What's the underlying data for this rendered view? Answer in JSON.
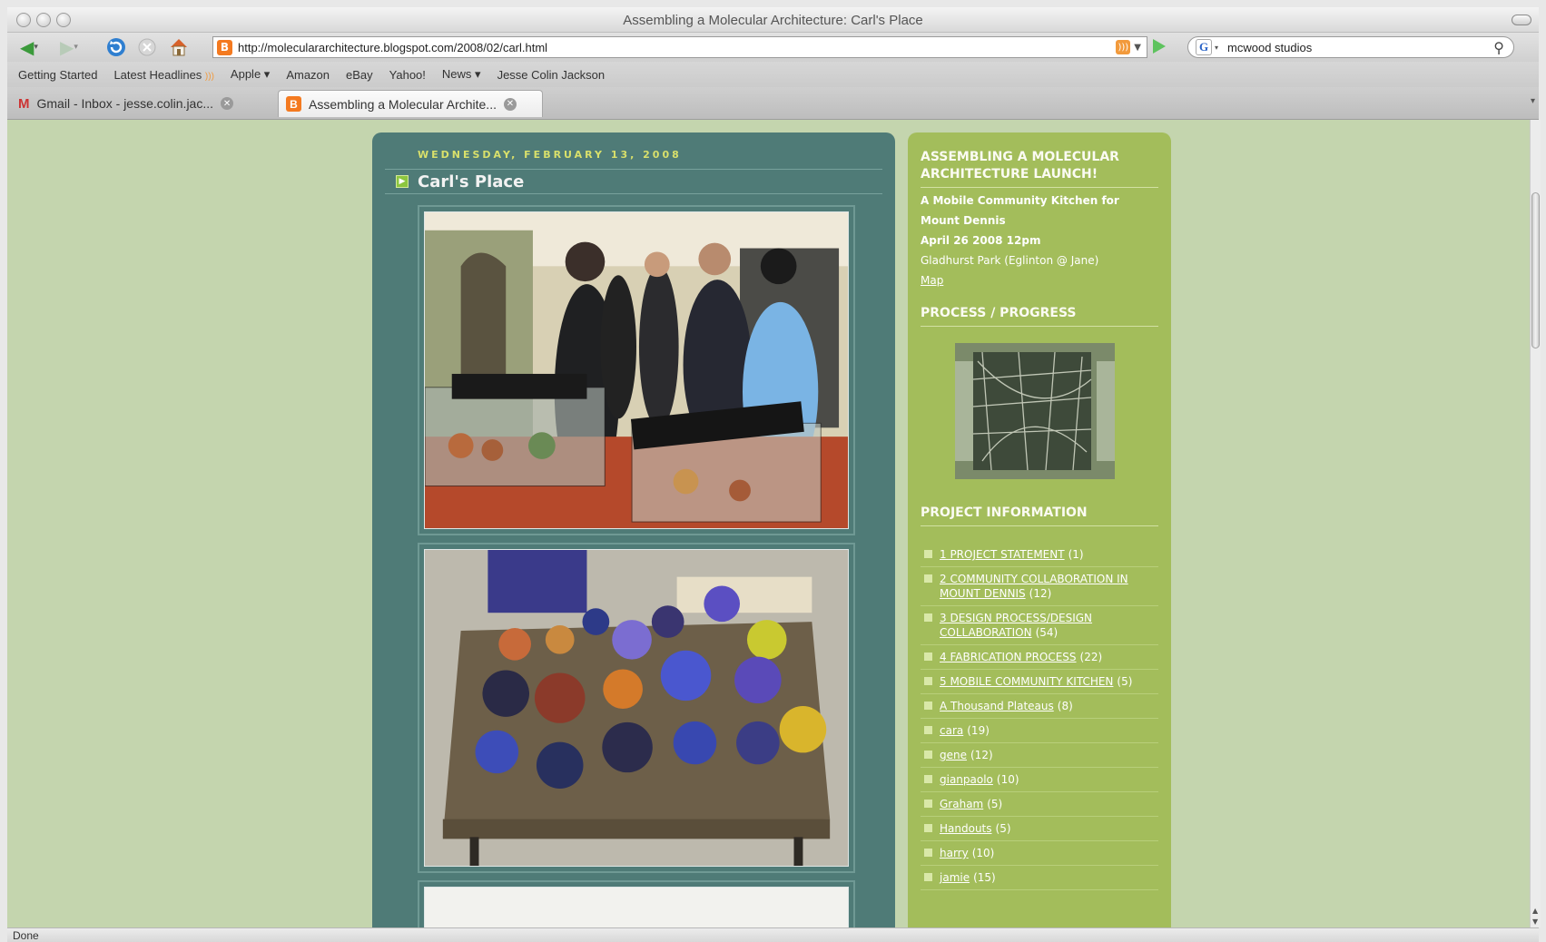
{
  "window": {
    "title": "Assembling a Molecular Architecture: Carl's Place"
  },
  "toolbar": {
    "url": "http://moleculararchitecture.blogspot.com/2008/02/carl.html",
    "search_value": "mcwood studios"
  },
  "bookmarks": [
    "Getting Started",
    "Latest Headlines",
    "Apple ▾",
    "Amazon",
    "eBay",
    "Yahoo!",
    "News ▾",
    "Jesse Colin Jackson"
  ],
  "tabs": [
    {
      "label": "Gmail - Inbox - jesse.colin.jac...",
      "active": false
    },
    {
      "label": "Assembling a Molecular Archite...",
      "active": true
    }
  ],
  "post": {
    "date": "WEDNESDAY, FEBRUARY 13, 2008",
    "title": "Carl's Place"
  },
  "sidebar": {
    "launch": {
      "heading": "ASSEMBLING A MOLECULAR ARCHITECTURE LAUNCH!",
      "line1": "A Mobile Community Kitchen for",
      "line2": "Mount Dennis",
      "line3": "April 26 2008 12pm",
      "line4": "Gladhurst Park (Eglinton @ Jane)",
      "map_link": "Map"
    },
    "progress_heading": "PROCESS / PROGRESS",
    "info_heading": "PROJECT INFORMATION",
    "categories": [
      {
        "name": "1 PROJECT STATEMENT",
        "count": "(1)"
      },
      {
        "name": "2 COMMUNITY COLLABORATION IN MOUNT DENNIS",
        "count": "(12)"
      },
      {
        "name": "3 DESIGN PROCESS/DESIGN COLLABORATION",
        "count": "(54)"
      },
      {
        "name": "4 FABRICATION PROCESS",
        "count": "(22)"
      },
      {
        "name": "5 MOBILE COMMUNITY KITCHEN",
        "count": "(5)"
      },
      {
        "name": "A Thousand Plateaus",
        "count": "(8)"
      },
      {
        "name": "cara",
        "count": "(19)"
      },
      {
        "name": "gene",
        "count": "(12)"
      },
      {
        "name": "gianpaolo",
        "count": "(10)"
      },
      {
        "name": "Graham",
        "count": "(5)"
      },
      {
        "name": "Handouts",
        "count": "(5)"
      },
      {
        "name": "harry",
        "count": "(10)"
      },
      {
        "name": "jamie",
        "count": "(15)"
      }
    ]
  },
  "status": {
    "text": "Done"
  },
  "colors": {
    "page_background": "#c4d5ae",
    "post_background": "#4f7b77",
    "sidebar_background": "#a3bd5b",
    "date_accent": "#d9e06b"
  },
  "icons": [
    "back-arrow-icon",
    "forward-arrow-icon",
    "reload-icon",
    "stop-icon",
    "home-icon",
    "blogger-favicon",
    "rss-icon",
    "go-arrow-icon",
    "google-icon",
    "search-icon",
    "gmail-icon",
    "tab-close-icon"
  ]
}
